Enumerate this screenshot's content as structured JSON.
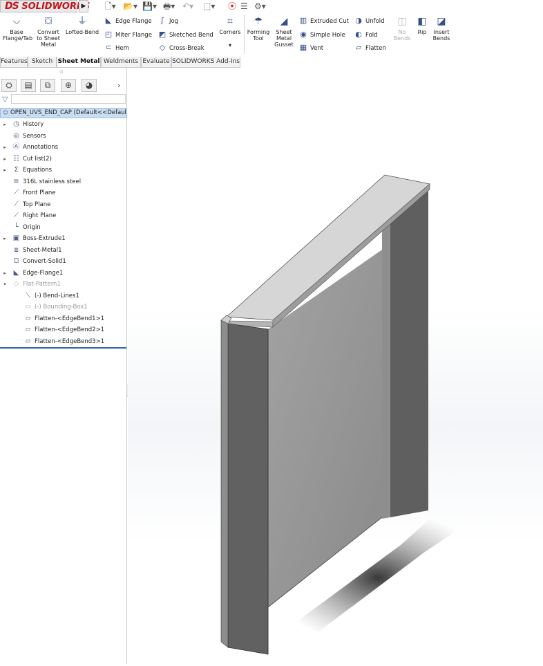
{
  "app": {
    "logo_ds": "DS",
    "logo_name": "SOLIDWORKS"
  },
  "quick_access": {
    "new_icon": "new-document-icon",
    "open_icon": "open-folder-icon",
    "save_icon": "save-icon",
    "print_icon": "print-icon",
    "undo_icon": "undo-icon",
    "select_icon": "select-arrow-icon",
    "rebuild_icon": "traffic-light-icon",
    "file_props_icon": "file-properties-icon",
    "options_icon": "gear-icon"
  },
  "ribbon": {
    "base_flange": "Base Flange/Tab",
    "convert": "Convert to Sheet Metal",
    "lofted_bend": "Lofted-Bend",
    "edge_flange": "Edge Flange",
    "miter_flange": "Miter Flange",
    "hem": "Hem",
    "jog": "Jog",
    "sketched_bend": "Sketched Bend",
    "cross_break": "Cross-Break",
    "corners": "Corners",
    "forming_tool": "Forming Tool",
    "sheet_metal_gusset": "Sheet Metal Gusset",
    "extruded_cut": "Extruded Cut",
    "simple_hole": "Simple Hole",
    "vent": "Vent",
    "unfold": "Unfold",
    "fold": "Fold",
    "flatten": "Flatten",
    "no_bends": "No Bends",
    "rip": "Rip",
    "insert_bends": "Insert Bends"
  },
  "tabs": [
    "Features",
    "Sketch",
    "Sheet Metal",
    "Weldments",
    "Evaluate",
    "SOLIDWORKS Add-Ins"
  ],
  "active_tab": "Sheet Metal",
  "feature_tree": {
    "root": "OPEN_UVS_END_CAP  (Default<<Default>",
    "items": [
      {
        "label": "History",
        "icon": "history-icon",
        "expandable": true
      },
      {
        "label": "Sensors",
        "icon": "sensor-icon",
        "expandable": false
      },
      {
        "label": "Annotations",
        "icon": "annotation-icon",
        "expandable": true
      },
      {
        "label": "Cut list(2)",
        "icon": "cut-list-icon",
        "expandable": true
      },
      {
        "label": "Equations",
        "icon": "equation-icon",
        "expandable": true
      },
      {
        "label": "316L stainless steel",
        "icon": "material-icon",
        "expandable": false
      },
      {
        "label": "Front Plane",
        "icon": "plane-icon",
        "expandable": false
      },
      {
        "label": "Top Plane",
        "icon": "plane-icon",
        "expandable": false
      },
      {
        "label": "Right Plane",
        "icon": "plane-icon",
        "expandable": false
      },
      {
        "label": "Origin",
        "icon": "origin-icon",
        "expandable": false
      },
      {
        "label": "Boss-Extrude1",
        "icon": "extrude-icon",
        "expandable": true
      },
      {
        "label": "Sheet-Metal1",
        "icon": "sheet-metal-icon",
        "expandable": false
      },
      {
        "label": "Convert-Solid1",
        "icon": "convert-solid-icon",
        "expandable": false
      },
      {
        "label": "Edge-Flange1",
        "icon": "edge-flange-icon",
        "expandable": true
      },
      {
        "label": "Flat-Pattern1",
        "icon": "flat-pattern-icon",
        "expandable": true
      },
      {
        "label": "(-) Bend-Lines1",
        "icon": "bend-lines-icon",
        "expandable": false
      },
      {
        "label": "(-) Bounding-Box1",
        "icon": "bounding-box-icon",
        "expandable": false
      },
      {
        "label": "Flatten-<EdgeBend1>1",
        "icon": "flatten-icon",
        "expandable": false
      },
      {
        "label": "Flatten-<EdgeBend2>1",
        "icon": "flatten-icon",
        "expandable": false
      },
      {
        "label": "Flatten-<EdgeBend3>1",
        "icon": "flatten-icon",
        "expandable": false
      }
    ]
  },
  "colors": {
    "brand_red": "#c3121c",
    "selection_blue": "#c9def2",
    "part_face": "#8c8c8c",
    "part_dark": "#5a5a5a"
  }
}
